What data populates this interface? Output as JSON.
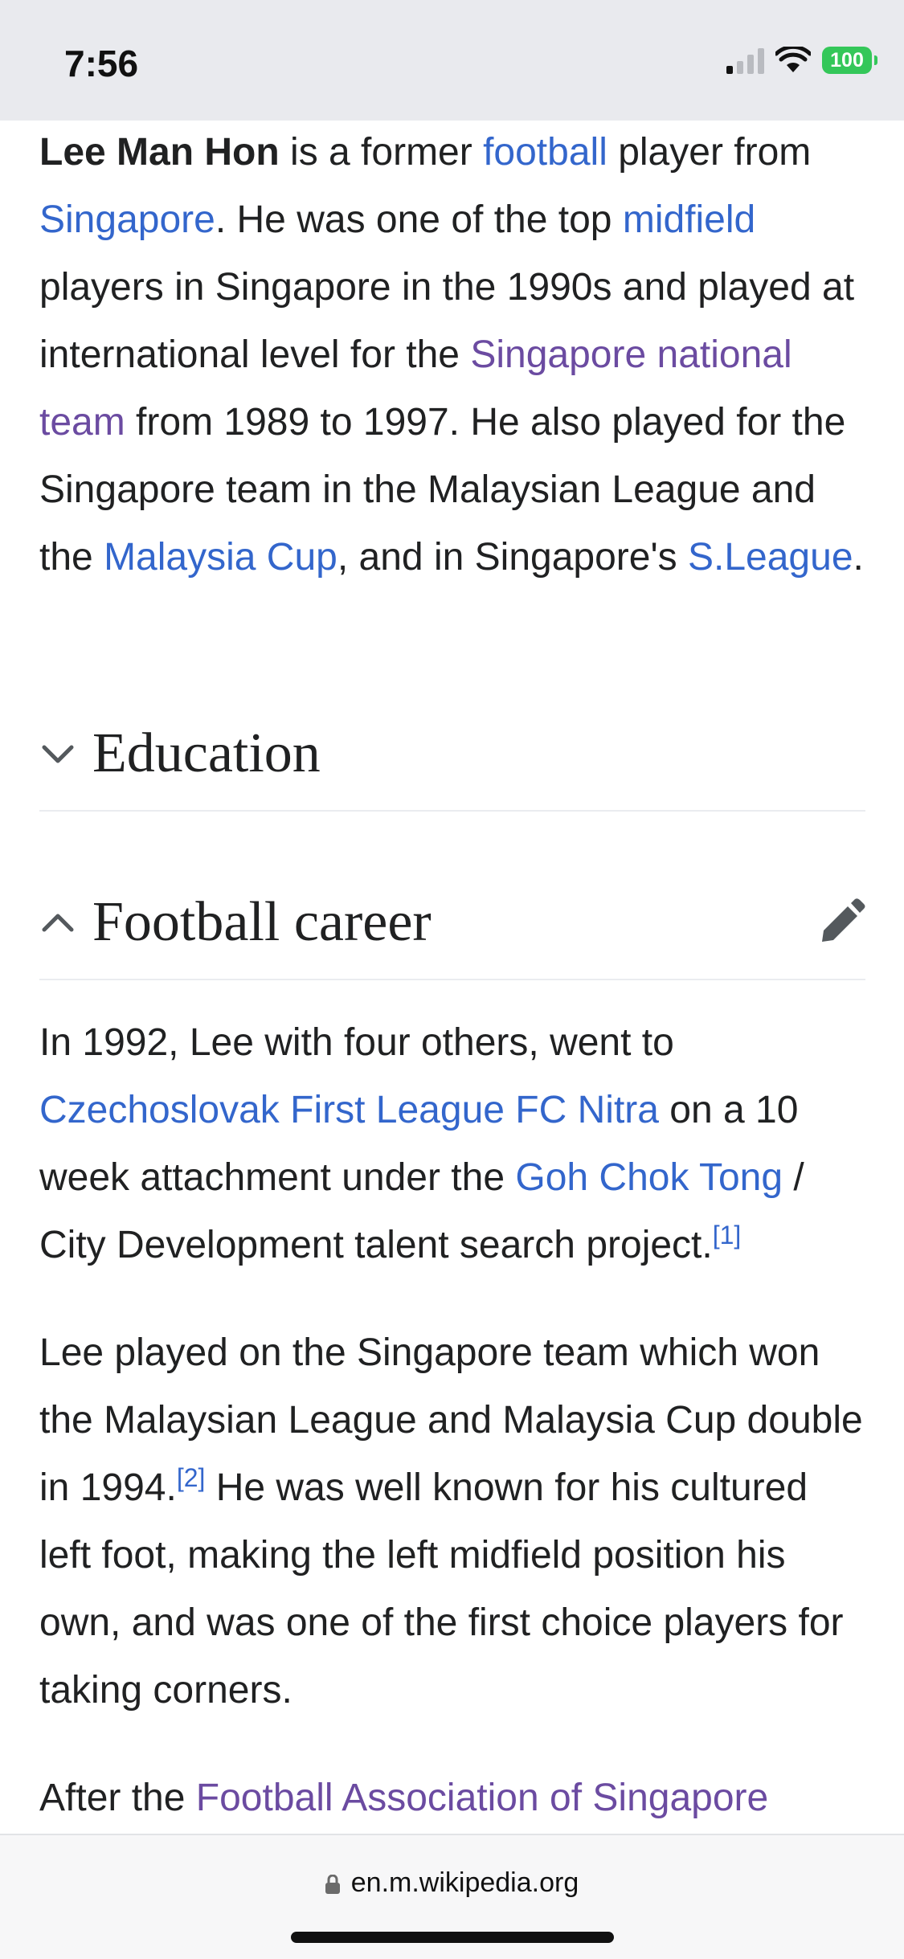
{
  "status_bar": {
    "time": "7:56",
    "battery": "100"
  },
  "intro": {
    "parts": [
      {
        "t": "Lee Man Hon",
        "c": "bold"
      },
      {
        "t": " is a former ",
        "c": ""
      },
      {
        "t": "football",
        "c": "link"
      },
      {
        "t": " player from ",
        "c": ""
      },
      {
        "t": "Singapore",
        "c": "link"
      },
      {
        "t": ". He was one of the top ",
        "c": ""
      },
      {
        "t": "midfield",
        "c": "link"
      },
      {
        "t": " players in Singapore in the 1990s and played at international level for the ",
        "c": ""
      },
      {
        "t": "Singapore national team",
        "c": "visited"
      },
      {
        "t": " from 1989 to 1997. He also played for the Singapore team in the Malaysian League and the ",
        "c": ""
      },
      {
        "t": "Malaysia Cup",
        "c": "link"
      },
      {
        "t": ", and in Singapore's ",
        "c": ""
      },
      {
        "t": "S.League",
        "c": "link"
      },
      {
        "t": ".",
        "c": ""
      }
    ]
  },
  "sections": {
    "education": {
      "title": "Education"
    },
    "football_career": {
      "title": "Football career"
    }
  },
  "career_p1": {
    "parts": [
      {
        "t": "In 1992, Lee with four others, went to ",
        "c": ""
      },
      {
        "t": "Czechoslovak First League FC Nitra",
        "c": "link"
      },
      {
        "t": " on a 10 week attachment under the ",
        "c": ""
      },
      {
        "t": "Goh Chok Tong",
        "c": "link"
      },
      {
        "t": " / City Development talent search project.",
        "c": ""
      },
      {
        "t": "[1]",
        "c": "ref"
      }
    ]
  },
  "career_p2": {
    "parts": [
      {
        "t": "Lee played on the Singapore team which won the Malaysian League and Malaysia Cup double in 1994.",
        "c": ""
      },
      {
        "t": "[2]",
        "c": "ref"
      },
      {
        "t": " He was well known for his cultured left foot, making the left midfield position his own, and was one of the first choice players for taking corners.",
        "c": ""
      }
    ]
  },
  "career_p3": {
    "parts": [
      {
        "t": "After the ",
        "c": ""
      },
      {
        "t": "Football Association of Singapore",
        "c": "visited"
      }
    ]
  },
  "browser": {
    "url": "en.m.wikipedia.org"
  },
  "colors": {
    "link": "#3366cc",
    "visited_link": "#6b4ba1",
    "battery": "#34c759"
  }
}
